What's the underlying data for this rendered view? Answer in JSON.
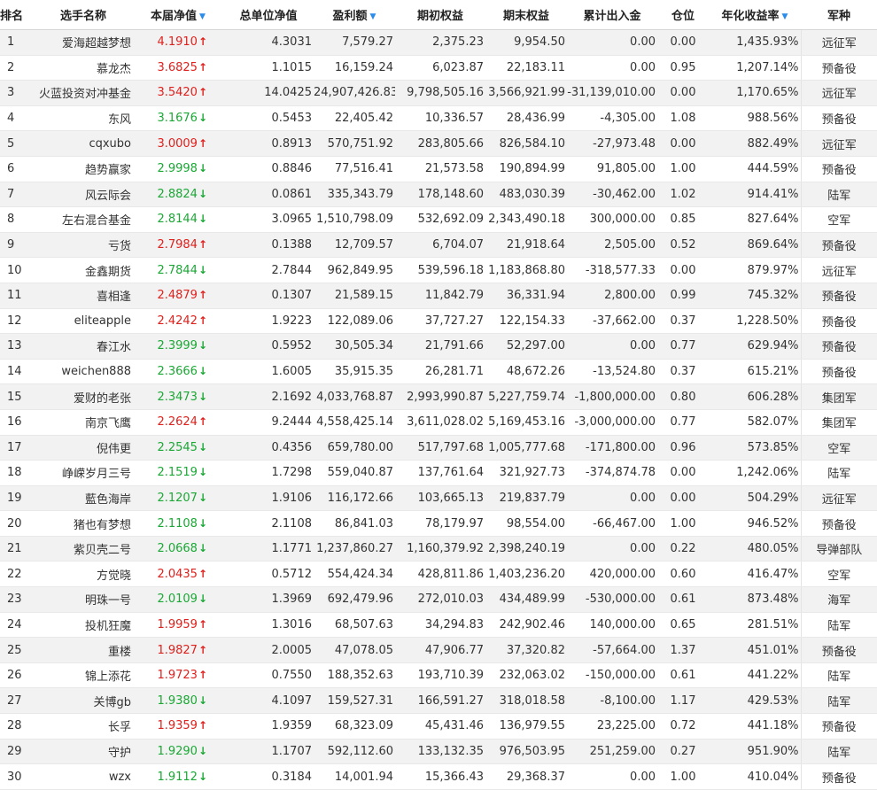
{
  "headers": {
    "rank": "排名",
    "name": "选手名称",
    "nav": "本届净值",
    "total_nav": "总单位净值",
    "profit": "盈利额",
    "begin_equity": "期初权益",
    "end_equity": "期末权益",
    "net_flow": "累计出入金",
    "position": "仓位",
    "annual": "年化收益率",
    "army": "军种"
  },
  "sort_indicator": "▼",
  "colors": {
    "up": "#e0201c",
    "down": "#1aa834",
    "sort": "#2a8be8"
  },
  "rows": [
    {
      "rank": "1",
      "name": "爱海超越梦想",
      "nav": "4.1910",
      "dir": "up",
      "total_nav": "4.3031",
      "profit": "7,579.27",
      "begin": "2,375.23",
      "end": "9,954.50",
      "flow": "0.00",
      "pos": "0.00",
      "annual": "1,435.93%",
      "army": "远征军"
    },
    {
      "rank": "2",
      "name": "慕龙杰",
      "nav": "3.6825",
      "dir": "up",
      "total_nav": "1.1015",
      "profit": "16,159.24",
      "begin": "6,023.87",
      "end": "22,183.11",
      "flow": "0.00",
      "pos": "0.95",
      "annual": "1,207.14%",
      "army": "预备役"
    },
    {
      "rank": "3",
      "name": "火蓝投资对冲基金",
      "nav": "3.5420",
      "dir": "up",
      "total_nav": "14.0425",
      "profit": "24,907,426.83",
      "begin": "9,798,505.16",
      "end": "3,566,921.99",
      "flow": "-31,139,010.00",
      "pos": "0.00",
      "annual": "1,170.65%",
      "army": "远征军"
    },
    {
      "rank": "4",
      "name": "东风",
      "nav": "3.1676",
      "dir": "down",
      "total_nav": "0.5453",
      "profit": "22,405.42",
      "begin": "10,336.57",
      "end": "28,436.99",
      "flow": "-4,305.00",
      "pos": "1.08",
      "annual": "988.56%",
      "army": "预备役"
    },
    {
      "rank": "5",
      "name": "cqxubo",
      "nav": "3.0009",
      "dir": "up",
      "total_nav": "0.8913",
      "profit": "570,751.92",
      "begin": "283,805.66",
      "end": "826,584.10",
      "flow": "-27,973.48",
      "pos": "0.00",
      "annual": "882.49%",
      "army": "远征军"
    },
    {
      "rank": "6",
      "name": "趋势赢家",
      "nav": "2.9998",
      "dir": "down",
      "total_nav": "0.8846",
      "profit": "77,516.41",
      "begin": "21,573.58",
      "end": "190,894.99",
      "flow": "91,805.00",
      "pos": "1.00",
      "annual": "444.59%",
      "army": "预备役"
    },
    {
      "rank": "7",
      "name": "风云际会",
      "nav": "2.8824",
      "dir": "down",
      "total_nav": "0.0861",
      "profit": "335,343.79",
      "begin": "178,148.60",
      "end": "483,030.39",
      "flow": "-30,462.00",
      "pos": "1.02",
      "annual": "914.41%",
      "army": "陆军"
    },
    {
      "rank": "8",
      "name": "左右混合基金",
      "nav": "2.8144",
      "dir": "down",
      "total_nav": "3.0965",
      "profit": "1,510,798.09",
      "begin": "532,692.09",
      "end": "2,343,490.18",
      "flow": "300,000.00",
      "pos": "0.85",
      "annual": "827.64%",
      "army": "空军"
    },
    {
      "rank": "9",
      "name": "亏货",
      "nav": "2.7984",
      "dir": "up",
      "total_nav": "0.1388",
      "profit": "12,709.57",
      "begin": "6,704.07",
      "end": "21,918.64",
      "flow": "2,505.00",
      "pos": "0.52",
      "annual": "869.64%",
      "army": "预备役"
    },
    {
      "rank": "10",
      "name": "金鑫期货",
      "nav": "2.7844",
      "dir": "down",
      "total_nav": "2.7844",
      "profit": "962,849.95",
      "begin": "539,596.18",
      "end": "1,183,868.80",
      "flow": "-318,577.33",
      "pos": "0.00",
      "annual": "879.97%",
      "army": "远征军"
    },
    {
      "rank": "11",
      "name": "喜相逢",
      "nav": "2.4879",
      "dir": "up",
      "total_nav": "0.1307",
      "profit": "21,589.15",
      "begin": "11,842.79",
      "end": "36,331.94",
      "flow": "2,800.00",
      "pos": "0.99",
      "annual": "745.32%",
      "army": "预备役"
    },
    {
      "rank": "12",
      "name": "eliteapple",
      "nav": "2.4242",
      "dir": "up",
      "total_nav": "1.9223",
      "profit": "122,089.06",
      "begin": "37,727.27",
      "end": "122,154.33",
      "flow": "-37,662.00",
      "pos": "0.37",
      "annual": "1,228.50%",
      "army": "预备役"
    },
    {
      "rank": "13",
      "name": "春江水",
      "nav": "2.3999",
      "dir": "down",
      "total_nav": "0.5952",
      "profit": "30,505.34",
      "begin": "21,791.66",
      "end": "52,297.00",
      "flow": "0.00",
      "pos": "0.77",
      "annual": "629.94%",
      "army": "预备役"
    },
    {
      "rank": "14",
      "name": "weichen888",
      "nav": "2.3666",
      "dir": "down",
      "total_nav": "1.6005",
      "profit": "35,915.35",
      "begin": "26,281.71",
      "end": "48,672.26",
      "flow": "-13,524.80",
      "pos": "0.37",
      "annual": "615.21%",
      "army": "预备役"
    },
    {
      "rank": "15",
      "name": "爱财的老张",
      "nav": "2.3473",
      "dir": "down",
      "total_nav": "2.1692",
      "profit": "4,033,768.87",
      "begin": "2,993,990.87",
      "end": "5,227,759.74",
      "flow": "-1,800,000.00",
      "pos": "0.80",
      "annual": "606.28%",
      "army": "集团军"
    },
    {
      "rank": "16",
      "name": "南京飞鹰",
      "nav": "2.2624",
      "dir": "up",
      "total_nav": "9.2444",
      "profit": "4,558,425.14",
      "begin": "3,611,028.02",
      "end": "5,169,453.16",
      "flow": "-3,000,000.00",
      "pos": "0.77",
      "annual": "582.07%",
      "army": "集团军"
    },
    {
      "rank": "17",
      "name": "倪伟更",
      "nav": "2.2545",
      "dir": "down",
      "total_nav": "0.4356",
      "profit": "659,780.00",
      "begin": "517,797.68",
      "end": "1,005,777.68",
      "flow": "-171,800.00",
      "pos": "0.96",
      "annual": "573.85%",
      "army": "空军"
    },
    {
      "rank": "18",
      "name": "峥嵘岁月三号",
      "nav": "2.1519",
      "dir": "down",
      "total_nav": "1.7298",
      "profit": "559,040.87",
      "begin": "137,761.64",
      "end": "321,927.73",
      "flow": "-374,874.78",
      "pos": "0.00",
      "annual": "1,242.06%",
      "army": "陆军"
    },
    {
      "rank": "19",
      "name": "藍色海岸",
      "nav": "2.1207",
      "dir": "down",
      "total_nav": "1.9106",
      "profit": "116,172.66",
      "begin": "103,665.13",
      "end": "219,837.79",
      "flow": "0.00",
      "pos": "0.00",
      "annual": "504.29%",
      "army": "远征军"
    },
    {
      "rank": "20",
      "name": "猪也有梦想",
      "nav": "2.1108",
      "dir": "down",
      "total_nav": "2.1108",
      "profit": "86,841.03",
      "begin": "78,179.97",
      "end": "98,554.00",
      "flow": "-66,467.00",
      "pos": "1.00",
      "annual": "946.52%",
      "army": "预备役"
    },
    {
      "rank": "21",
      "name": "紫贝壳二号",
      "nav": "2.0668",
      "dir": "down",
      "total_nav": "1.1771",
      "profit": "1,237,860.27",
      "begin": "1,160,379.92",
      "end": "2,398,240.19",
      "flow": "0.00",
      "pos": "0.22",
      "annual": "480.05%",
      "army": "导弹部队"
    },
    {
      "rank": "22",
      "name": "方觉晓",
      "nav": "2.0435",
      "dir": "up",
      "total_nav": "0.5712",
      "profit": "554,424.34",
      "begin": "428,811.86",
      "end": "1,403,236.20",
      "flow": "420,000.00",
      "pos": "0.60",
      "annual": "416.47%",
      "army": "空军"
    },
    {
      "rank": "23",
      "name": "明珠一号",
      "nav": "2.0109",
      "dir": "down",
      "total_nav": "1.3969",
      "profit": "692,479.96",
      "begin": "272,010.03",
      "end": "434,489.99",
      "flow": "-530,000.00",
      "pos": "0.61",
      "annual": "873.48%",
      "army": "海军"
    },
    {
      "rank": "24",
      "name": "投机狂魔",
      "nav": "1.9959",
      "dir": "up",
      "total_nav": "1.3016",
      "profit": "68,507.63",
      "begin": "34,294.83",
      "end": "242,902.46",
      "flow": "140,000.00",
      "pos": "0.65",
      "annual": "281.51%",
      "army": "陆军"
    },
    {
      "rank": "25",
      "name": "重楼",
      "nav": "1.9827",
      "dir": "up",
      "total_nav": "2.0005",
      "profit": "47,078.05",
      "begin": "47,906.77",
      "end": "37,320.82",
      "flow": "-57,664.00",
      "pos": "1.37",
      "annual": "451.01%",
      "army": "预备役"
    },
    {
      "rank": "26",
      "name": "锦上添花",
      "nav": "1.9723",
      "dir": "up",
      "total_nav": "0.7550",
      "profit": "188,352.63",
      "begin": "193,710.39",
      "end": "232,063.02",
      "flow": "-150,000.00",
      "pos": "0.61",
      "annual": "441.22%",
      "army": "陆军"
    },
    {
      "rank": "27",
      "name": "关博gb",
      "nav": "1.9380",
      "dir": "down",
      "total_nav": "4.1097",
      "profit": "159,527.31",
      "begin": "166,591.27",
      "end": "318,018.58",
      "flow": "-8,100.00",
      "pos": "1.17",
      "annual": "429.53%",
      "army": "陆军"
    },
    {
      "rank": "28",
      "name": "长孚",
      "nav": "1.9359",
      "dir": "up",
      "total_nav": "1.9359",
      "profit": "68,323.09",
      "begin": "45,431.46",
      "end": "136,979.55",
      "flow": "23,225.00",
      "pos": "0.72",
      "annual": "441.18%",
      "army": "预备役"
    },
    {
      "rank": "29",
      "name": "守护",
      "nav": "1.9290",
      "dir": "down",
      "total_nav": "1.1707",
      "profit": "592,112.60",
      "begin": "133,132.35",
      "end": "976,503.95",
      "flow": "251,259.00",
      "pos": "0.27",
      "annual": "951.90%",
      "army": "陆军"
    },
    {
      "rank": "30",
      "name": "wzx",
      "nav": "1.9112",
      "dir": "down",
      "total_nav": "0.3184",
      "profit": "14,001.94",
      "begin": "15,366.43",
      "end": "29,368.37",
      "flow": "0.00",
      "pos": "1.00",
      "annual": "410.04%",
      "army": "预备役"
    }
  ]
}
